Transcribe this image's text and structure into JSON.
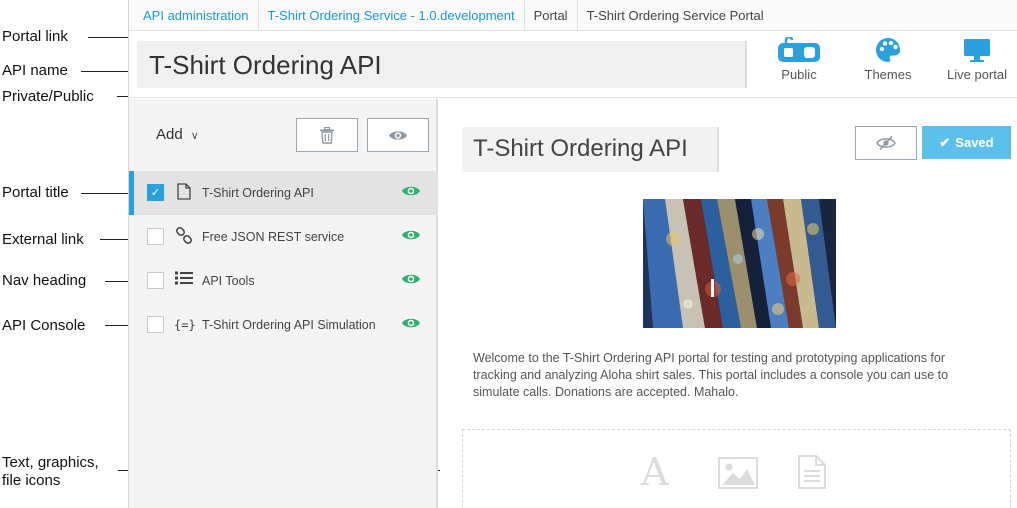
{
  "annotations": {
    "portal_link": "Portal link",
    "api_name": "API name",
    "private_public": "Private/Public",
    "portal_title": "Portal title",
    "external_link": "External link",
    "nav_heading": "Nav heading",
    "api_console": "API Console",
    "text_graphics_1": "Text, graphics,",
    "text_graphics_2": "file icons"
  },
  "breadcrumb": [
    {
      "label": "API administration"
    },
    {
      "label": "T-Shirt Ordering Service - 1.0.development"
    },
    {
      "label": "Portal"
    },
    {
      "label": "T-Shirt Ordering Service Portal"
    }
  ],
  "header": {
    "api_name": "T-Shirt Ordering API",
    "public_label": "Public",
    "themes_label": "Themes",
    "live_portal_label": "Live portal"
  },
  "sidebar": {
    "add_label": "Add",
    "items": [
      {
        "label": "T-Shirt Ordering API",
        "icon": "page-icon",
        "checked": true,
        "active": true
      },
      {
        "label": "Free JSON REST service",
        "icon": "link-icon",
        "checked": false,
        "active": false
      },
      {
        "label": "API Tools",
        "icon": "list-icon",
        "checked": false,
        "active": false
      },
      {
        "label": "T-Shirt Ordering API Simulation",
        "icon": "console-icon",
        "checked": false,
        "active": false
      }
    ]
  },
  "main": {
    "portal_title": "T-Shirt Ordering API",
    "saved_label": "Saved",
    "intro_text": "Welcome to the T-Shirt Ordering API portal for testing and prototyping applications for tracking and analyzing Aloha shirt sales. This portal includes a console you can use to simulate calls. Donations are accepted. Mahalo."
  },
  "colors": {
    "accent": "#2aa0dc",
    "saved_button": "#5bc0ea",
    "eye_visible": "#2db36b",
    "link": "#1a9ad6"
  }
}
